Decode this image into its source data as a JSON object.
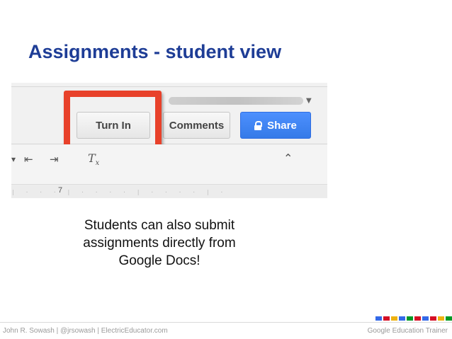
{
  "slide": {
    "title": "Assignments - student view",
    "caption_lines": [
      "Students can also submit",
      "assignments directly from",
      "Google Docs!"
    ]
  },
  "screenshot": {
    "buttons": {
      "turn_in": "Turn In",
      "comments": "Comments",
      "share": "Share"
    },
    "ruler_number": "7",
    "icons": [
      "indent-decrease-icon",
      "indent-increase-icon",
      "clear-formatting-icon",
      "collapse-icon",
      "lock-icon",
      "dropdown-caret-icon"
    ],
    "colors": {
      "highlight": "#e8412a",
      "share_button": "#4d90fe"
    }
  },
  "footer": {
    "left": "John R. Sowash | @jrsowash | ElectricEducator.com",
    "right": "Google Education Trainer"
  },
  "colors": {
    "title": "#1e3d96",
    "footer_squares": [
      "#3369e8",
      "#d50f25",
      "#eeb211",
      "#3369e8",
      "#009925",
      "#d50f25",
      "#3369e8",
      "#d50f25",
      "#eeb211",
      "#009925"
    ]
  }
}
